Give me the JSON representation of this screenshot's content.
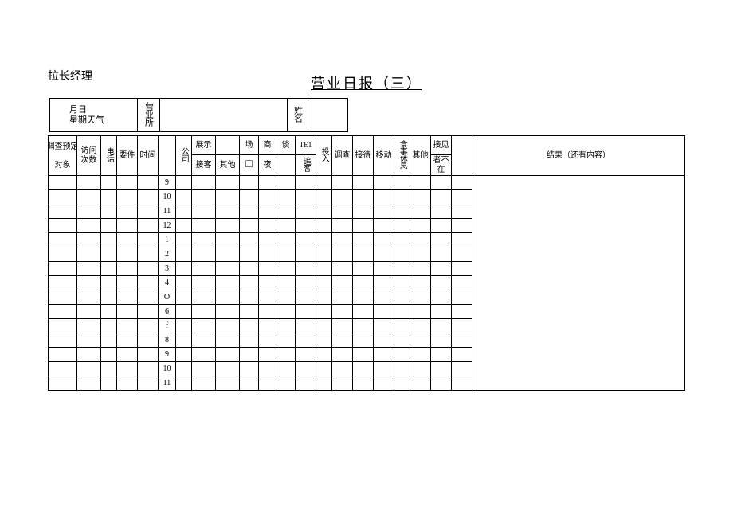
{
  "manager": "拉长经理",
  "title": "营业日报（三）",
  "info": {
    "date_top": "月日",
    "date_bottom": "星期天气",
    "office_label": "营业所",
    "office_value": "",
    "name_label": "姓名",
    "name_value": ""
  },
  "headers": {
    "survey_pre": "调查预定",
    "target": "对象",
    "visit_count": "访问次数",
    "phone": "电话",
    "matter": "要件",
    "time": "时间",
    "company": "公司",
    "display": "展示",
    "reception": "接客",
    "other1": "其他",
    "venue": "场",
    "checkbox": "□",
    "biz": "商",
    "night": "夜",
    "talk": "谈",
    "te1": "TE1",
    "chase": "追客",
    "invest": "投入",
    "survey": "调查",
    "treat": "接待",
    "move": "移动",
    "meal_rest": "食事休息",
    "other2": "其他",
    "meet": "接见",
    "absent": "者不在",
    "result": "结果（还有内容）"
  },
  "time_labels": [
    "9",
    "10",
    "11",
    "12",
    "1",
    "2",
    "3",
    "4",
    "O",
    "6",
    "f",
    "8",
    "9",
    "10",
    "11"
  ],
  "row_count": 15,
  "col_count_before_time": 5,
  "col_count_after_time": 16
}
